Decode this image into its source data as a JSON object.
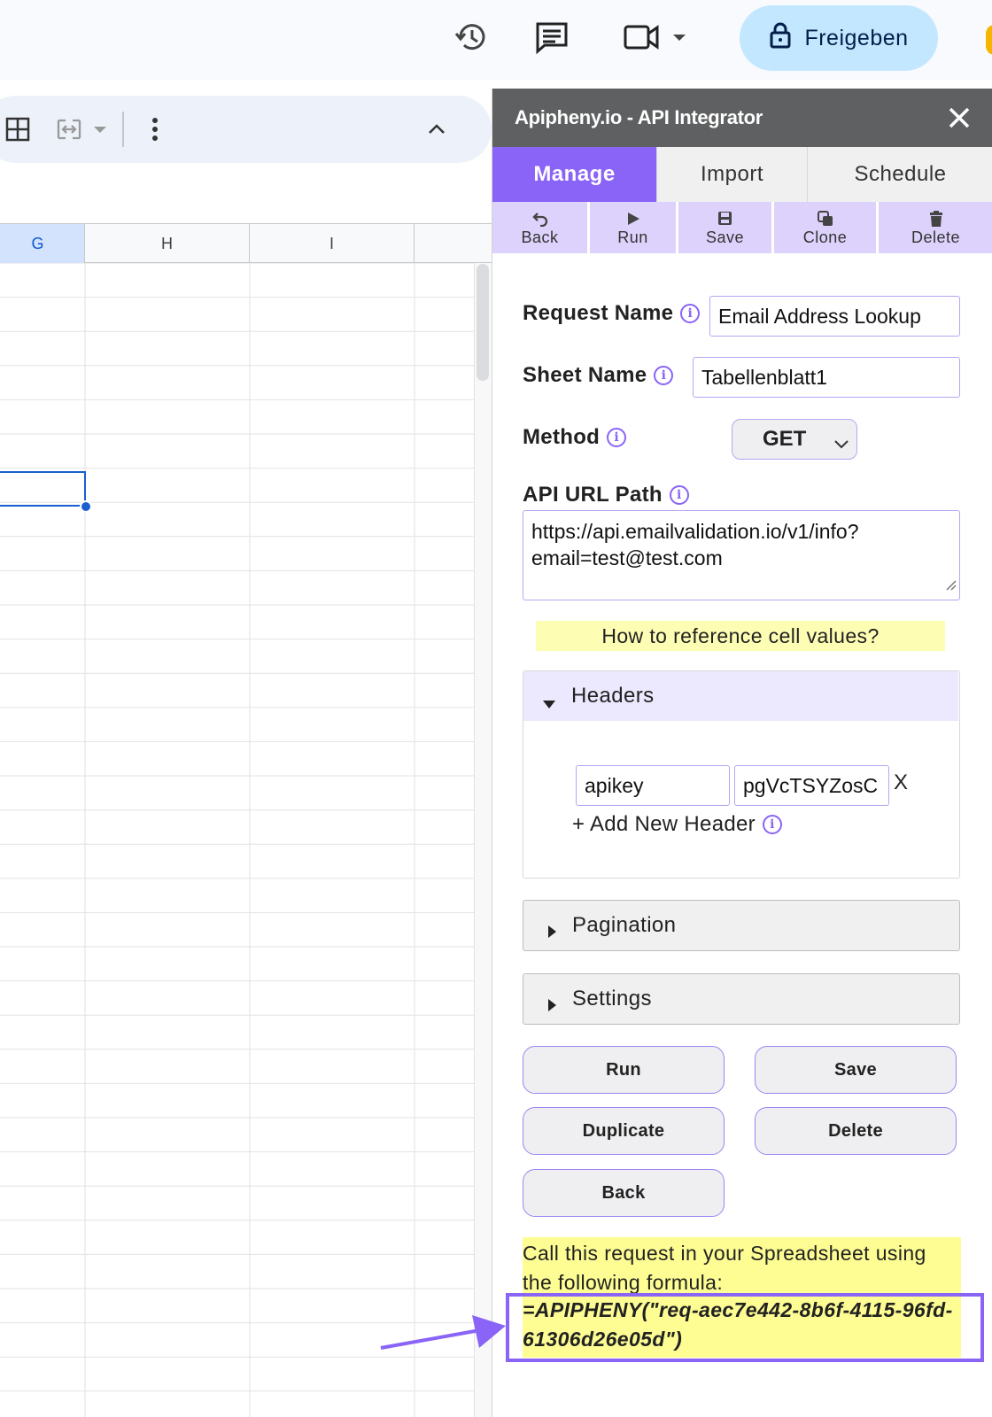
{
  "topbar": {
    "share_label": "Freigeben",
    "icons": [
      "history-icon",
      "comment-icon",
      "video-call-icon",
      "lock-icon"
    ]
  },
  "sheet_toolbar": {
    "icons": [
      "borders-icon",
      "merge-cells-icon",
      "more-vert-icon",
      "collapse-up-icon"
    ]
  },
  "grid": {
    "columns": [
      "G",
      "H",
      "I"
    ],
    "selected_column": "G"
  },
  "panel": {
    "title": "Apipheny.io - API Integrator",
    "tabs": [
      {
        "label": "Manage",
        "active": true
      },
      {
        "label": "Import",
        "active": false
      },
      {
        "label": "Schedule",
        "active": false
      }
    ],
    "actions": [
      {
        "label": "Back",
        "icon": "undo-icon"
      },
      {
        "label": "Run",
        "icon": "play-icon"
      },
      {
        "label": "Save",
        "icon": "floppy-icon"
      },
      {
        "label": "Clone",
        "icon": "copy-icon"
      },
      {
        "label": "Delete",
        "icon": "trash-icon"
      }
    ],
    "form": {
      "request_name_label": "Request Name",
      "request_name_value": "Email Address Lookup",
      "sheet_name_label": "Sheet Name",
      "sheet_name_value": "Tabellenblatt1",
      "method_label": "Method",
      "method_value": "GET",
      "url_label": "API URL Path",
      "url_value": "https://api.emailvalidation.io/v1/info?\nemail=test@test.com",
      "howto_link": "How to reference cell values?"
    },
    "headers": {
      "title": "Headers",
      "key": "apikey",
      "value": "pgVcTSYZosC",
      "remove": "X",
      "add_label": "+ Add New Header"
    },
    "pagination_label": "Pagination",
    "settings_label": "Settings",
    "buttons": {
      "run": "Run",
      "save": "Save",
      "duplicate": "Duplicate",
      "delete": "Delete",
      "back": "Back"
    },
    "formula": {
      "intro": "Call this request in your Spreadsheet using the following formula:",
      "code": "=APIPHENY(\"req-aec7e442-8b6f-4115-96fd-61306d26e05d\")"
    }
  },
  "colors": {
    "accent": "#8a63f7",
    "action_bg": "#ddd2fb",
    "title_bg": "#5f6061",
    "highlight": "#fdfd93",
    "share_bg": "#c2e7ff",
    "selection": "#1a5fd0"
  }
}
